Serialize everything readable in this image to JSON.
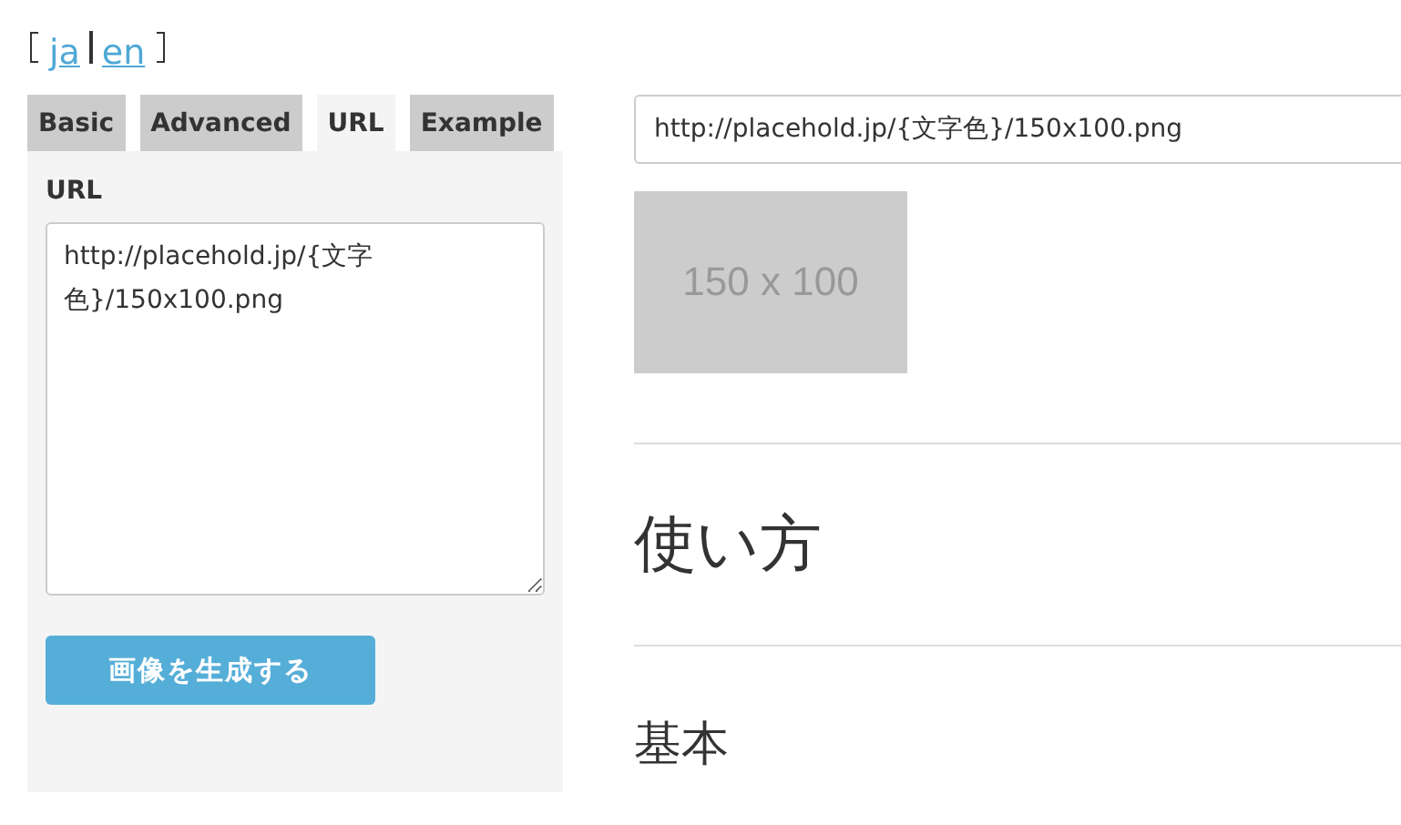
{
  "languages": [
    {
      "label": "ja"
    },
    {
      "label": "en"
    }
  ],
  "tabs": [
    {
      "label": "Basic",
      "selected": false
    },
    {
      "label": "Advanced",
      "selected": false
    },
    {
      "label": "URL",
      "selected": true
    },
    {
      "label": "Example",
      "selected": false
    }
  ],
  "url_form": {
    "label": "URL",
    "value": "http://placehold.jp/{文字色}/150x100.png",
    "button": "画像を生成する"
  },
  "preview": {
    "url": "http://placehold.jp/{文字色}/150x100.png",
    "image_text": "150 x 100"
  },
  "headings": [
    {
      "text": "使い方",
      "kind": "h2"
    },
    {
      "text": "基本",
      "kind": "h3"
    }
  ]
}
